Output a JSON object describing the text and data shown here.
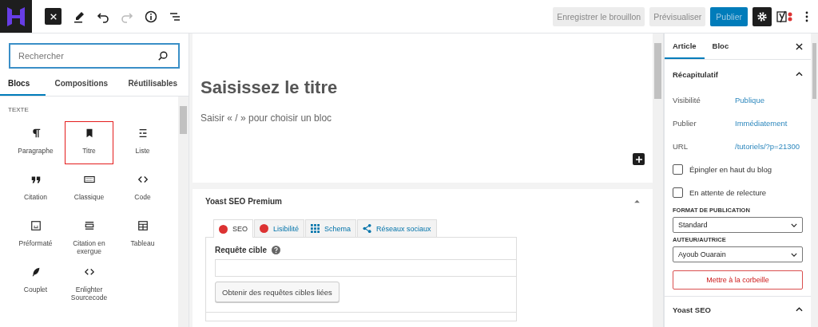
{
  "toolbar": {
    "save_draft": "Enregistrer le brouillon",
    "preview": "Prévisualiser",
    "publish": "Publier"
  },
  "inserter": {
    "search": {
      "placeholder": "Rechercher"
    },
    "tabs": [
      {
        "label": "Blocs",
        "selected": true
      },
      {
        "label": "Compositions",
        "selected": false
      },
      {
        "label": "Réutilisables",
        "selected": false
      }
    ],
    "category": "TEXTE",
    "blocks": [
      {
        "label": "Paragraphe",
        "selected": false
      },
      {
        "label": "Titre",
        "selected": true
      },
      {
        "label": "Liste",
        "selected": false
      },
      {
        "label": "Citation",
        "selected": false
      },
      {
        "label": "Classique",
        "selected": false
      },
      {
        "label": "Code",
        "selected": false
      },
      {
        "label": "Préformaté",
        "selected": false
      },
      {
        "label": "Citation en exergue",
        "selected": false
      },
      {
        "label": "Tableau",
        "selected": false
      },
      {
        "label": "Couplet",
        "selected": false
      },
      {
        "label": "Enlighter Sourcecode",
        "selected": false
      }
    ]
  },
  "editor": {
    "title_placeholder": "Saisissez le titre",
    "block_placeholder": "Saisir « / » pour choisir un bloc",
    "yoast": {
      "title": "Yoast SEO Premium",
      "tabs": [
        {
          "label": "SEO",
          "kind": "dot",
          "color": "#dc3232",
          "selected": true
        },
        {
          "label": "Lisibilité",
          "kind": "dot",
          "color": "#dc3232",
          "selected": false
        },
        {
          "label": "Schema",
          "kind": "grid",
          "selected": false
        },
        {
          "label": "Réseaux sociaux",
          "kind": "share",
          "selected": false
        }
      ],
      "field_label": "Requête cible",
      "button": "Obtenir des requêtes cibles liées"
    }
  },
  "sidebar": {
    "tabs": [
      {
        "label": "Article",
        "selected": true
      },
      {
        "label": "Bloc",
        "selected": false
      }
    ],
    "summary_title": "Récapitulatif",
    "rows": [
      {
        "label": "Visibilité",
        "value": "Publique"
      },
      {
        "label": "Publier",
        "value": "Immédiatement"
      },
      {
        "label": "URL",
        "value": "/tutoriels/?p=21300"
      }
    ],
    "checkboxes": [
      {
        "label": "Épingler en haut du blog",
        "checked": false
      },
      {
        "label": "En attente de relecture",
        "checked": false
      }
    ],
    "selects": [
      {
        "label": "FORMAT DE PUBLICATION",
        "value": "Standard"
      },
      {
        "label": "AUTEUR/AUTRICE",
        "value": "Ayoub Ouarain"
      }
    ],
    "trash": "Mettre à la corbeille",
    "yoast_title": "Yoast SEO"
  }
}
